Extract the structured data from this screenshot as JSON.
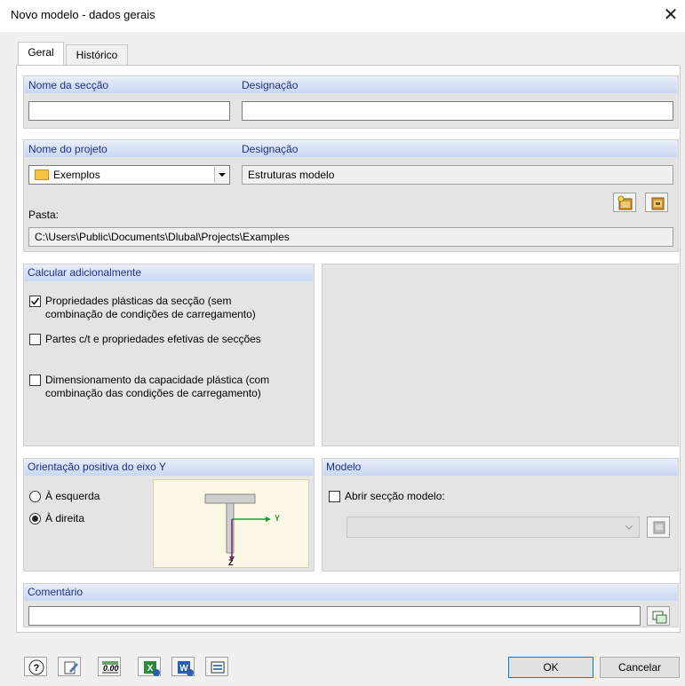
{
  "window": {
    "title": "Novo modelo - dados gerais",
    "close": "✕"
  },
  "tabs": [
    "Geral",
    "Histórico"
  ],
  "section": {
    "name_label": "Nome da secção",
    "designation_label": "Designação",
    "name_value": "",
    "designation_value": ""
  },
  "project": {
    "name_label": "Nome do projeto",
    "designation_label": "Designação",
    "selected": "Exemplos",
    "designation_value": "Estruturas modelo",
    "folder_label": "Pasta:",
    "folder_path": "C:\\Users\\Public\\Documents\\Dlubal\\Projects\\Examples"
  },
  "calc": {
    "header": "Calcular adicionalmente",
    "options": [
      {
        "label_l1": "Propriedades plásticas da secção (sem",
        "label_l2": "combinação de condições de carregamento)",
        "checked": true
      },
      {
        "label_l1": "Partes c/t e propriedades efetivas de secções",
        "label_l2": "",
        "checked": false
      },
      {
        "label_l1": "Dimensionamento da capacidade plástica (com",
        "label_l2": "combinação das condições de carregamento)",
        "checked": false
      }
    ]
  },
  "orientation": {
    "header": "Orientação positiva do eixo Y",
    "left_label": "À esquerda",
    "right_label": "À direita",
    "selected": "right",
    "axis_y": "Y",
    "axis_z": "Z"
  },
  "model": {
    "header": "Modelo",
    "open_label": "Abrir secção modelo:",
    "checked": false,
    "selected": ""
  },
  "comment": {
    "header": "Comentário",
    "value": ""
  },
  "footer": {
    "ok": "OK",
    "cancel": "Cancelar",
    "numeric_icon_text": "0.00"
  },
  "colors": {
    "header_text": "#1e2f8a",
    "header_bg": "#c9d7f1",
    "axis_green": "#1f9a3b",
    "axis_purple": "#7a1f6a"
  }
}
